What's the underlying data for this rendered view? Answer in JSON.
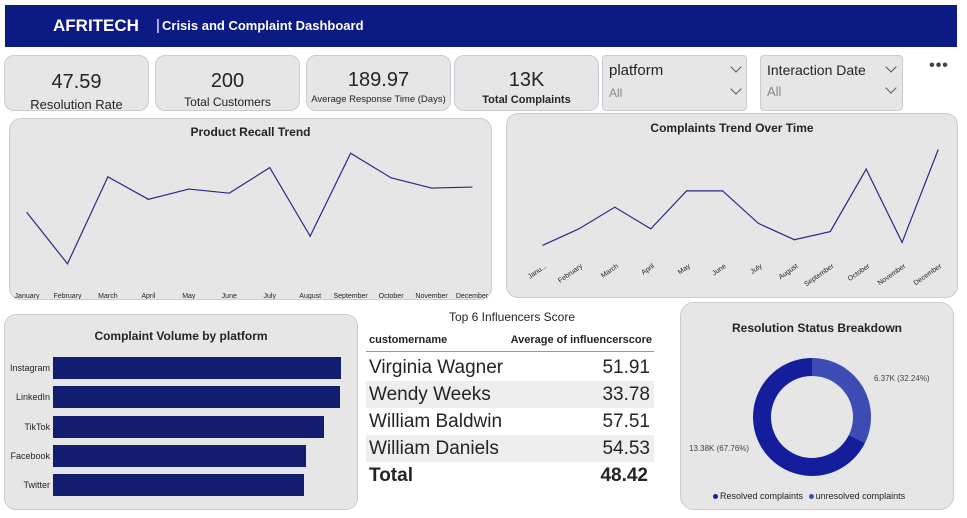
{
  "header": {
    "brand": "AFRITECH",
    "separator": "|",
    "subtitle": "Crisis and  Complaint Dashboard"
  },
  "kpis": [
    {
      "value": "47.59",
      "label": "Resolution Rate"
    },
    {
      "value": "200",
      "label": "Total Customers"
    },
    {
      "value": "189.97",
      "label": "Average Response Time (Days)"
    },
    {
      "value": "13K",
      "label": "Total Complaints"
    }
  ],
  "slicers": [
    {
      "title": "platform",
      "value": "All"
    },
    {
      "title": "Interaction Date",
      "value": "All"
    }
  ],
  "more_options": "•••",
  "chart_data": [
    {
      "type": "line",
      "title": "Product Recall Trend",
      "categories": [
        "January",
        "February",
        "March",
        "April",
        "May",
        "June",
        "July",
        "August",
        "September",
        "October",
        "November",
        "December"
      ],
      "values": [
        60,
        10,
        95,
        73,
        83,
        79,
        104,
        37,
        118,
        94,
        84,
        85
      ],
      "ylim": [
        0,
        130
      ],
      "grid": false,
      "color": "#262b80"
    },
    {
      "type": "line",
      "title": "Complaints Trend Over Time",
      "categories": [
        "Janu...",
        "February",
        "March",
        "April",
        "May",
        "June",
        "July",
        "August",
        "September",
        "October",
        "November",
        "December"
      ],
      "values": [
        1010,
        1040,
        1080,
        1040,
        1110,
        1110,
        1050,
        1020,
        1035,
        1150,
        1015,
        1185
      ],
      "ylim": [
        990,
        1200
      ],
      "grid": false,
      "color": "#262b80"
    },
    {
      "type": "bar",
      "orientation": "horizontal",
      "title": "Complaint Volume by platform",
      "categories": [
        "Instagram",
        "LinkedIn",
        "TikTok",
        "Facebook",
        "Twitter"
      ],
      "values": [
        2720,
        2710,
        2560,
        2390,
        2370
      ],
      "xlim": [
        0,
        2720
      ],
      "color": "#121d6f"
    },
    {
      "type": "pie",
      "donut": true,
      "title": "Resolution Status Breakdown",
      "slices": [
        {
          "name": "Resolved complaints",
          "value": 13380,
          "label": "13.38K (67.76%)",
          "color": "#141e9c"
        },
        {
          "name": "unresolved complaints",
          "value": 6370,
          "label": "6.37K (32.24%)",
          "color": "#3d4bb5"
        }
      ],
      "legend": "bottom"
    }
  ],
  "table": {
    "title": "Top 6 Influencers Score",
    "columns": [
      "customername",
      "Average of influencerscore"
    ],
    "rows": [
      [
        "Virginia Wagner",
        "51.91"
      ],
      [
        "Wendy Weeks",
        "33.78"
      ],
      [
        "William Baldwin",
        "57.51"
      ],
      [
        "William Daniels",
        "54.53"
      ]
    ],
    "total": [
      "Total",
      "48.42"
    ]
  }
}
